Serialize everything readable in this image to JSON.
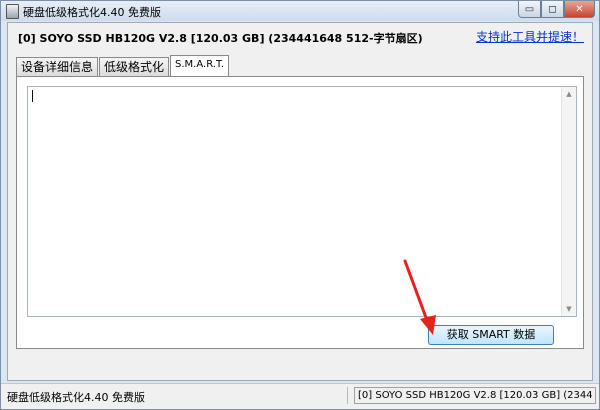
{
  "window": {
    "title": "硬盘低级格式化4.40   免费版",
    "controls": {
      "minimize": "▭",
      "maximize": "◻",
      "close": "✕"
    }
  },
  "header": {
    "disk_info": "[0]  SOYO SSD HB120G   V2.8   [120.03 GB]   (234441648 512-字节扇区)",
    "support_link": "支持此工具并提速！"
  },
  "tabs": [
    {
      "label": "设备详细信息",
      "active": false
    },
    {
      "label": "低级格式化",
      "active": false
    },
    {
      "label": "S.M.A.R.T.",
      "active": true
    }
  ],
  "smart_panel": {
    "output_text": "",
    "get_smart_button": "获取 SMART 数据"
  },
  "scrollbar": {
    "up": "▲",
    "down": "▼"
  },
  "statusbar": {
    "left": "硬盘低级格式化4.40   免费版",
    "right": "[0]  SOYO SSD HB120G   V2.8   [120.03 GB]   (2344"
  },
  "colors": {
    "link": "#0033cc",
    "annotation_arrow": "#e5231b",
    "close_button": "#c6452f"
  },
  "icons": {
    "app": "hard-drive-icon",
    "annotation": "red-arrow-icon"
  }
}
